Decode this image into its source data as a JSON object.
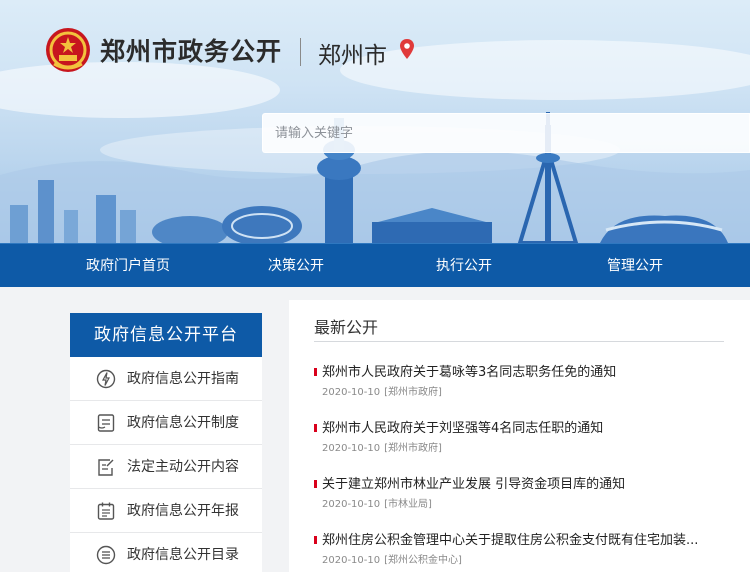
{
  "header": {
    "site_title": "郑州市政务公开",
    "city": "郑州市",
    "search_placeholder": "请输入关键字"
  },
  "nav": {
    "items": [
      "政府门户首页",
      "决策公开",
      "执行公开",
      "管理公开"
    ]
  },
  "sidebar": {
    "header": "政府信息公开平台",
    "items": [
      {
        "label": "政府信息公开指南",
        "icon": "compass-icon"
      },
      {
        "label": "政府信息公开制度",
        "icon": "document-list-icon"
      },
      {
        "label": "法定主动公开内容",
        "icon": "edit-document-icon"
      },
      {
        "label": "政府信息公开年报",
        "icon": "calendar-report-icon"
      },
      {
        "label": "政府信息公开目录",
        "icon": "catalog-list-icon"
      }
    ]
  },
  "main": {
    "section_title": "最新公开",
    "news": [
      {
        "title": "郑州市人民政府关于葛咏等3名同志职务任免的通知",
        "date": "2020-10-10",
        "source": "[郑州市政府]"
      },
      {
        "title": "郑州市人民政府关于刘坚强等4名同志任职的通知",
        "date": "2020-10-10",
        "source": "[郑州市政府]"
      },
      {
        "title": "关于建立郑州市林业产业发展 引导资金项目库的通知",
        "date": "2020-10-10",
        "source": "[市林业局]"
      },
      {
        "title": "郑州住房公积金管理中心关于提取住房公积金支付既有住宅加装...",
        "date": "2020-10-10",
        "source": "[郑州公积金中心]"
      }
    ]
  },
  "colors": {
    "primary_blue": "#0e5aa7",
    "accent_red": "#d9001b",
    "location_pin": "#e03a3a"
  }
}
